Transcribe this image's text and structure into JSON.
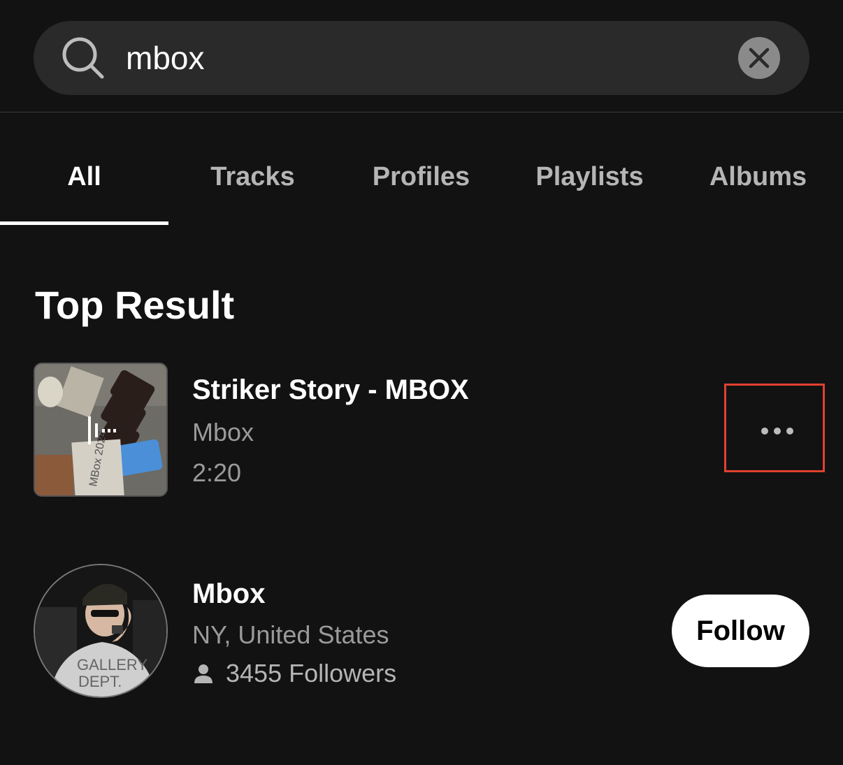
{
  "search": {
    "query": "mbox",
    "search_icon": "search-icon",
    "clear_icon": "close-circle-icon"
  },
  "tabs": [
    {
      "label": "All",
      "active": true
    },
    {
      "label": "Tracks",
      "active": false
    },
    {
      "label": "Profiles",
      "active": false
    },
    {
      "label": "Playlists",
      "active": false
    },
    {
      "label": "Albums",
      "active": false
    }
  ],
  "section": {
    "title": "Top Result"
  },
  "track": {
    "title": "Striker Story - MBOX",
    "artist": "Mbox",
    "duration": "2:20",
    "art_overlay_icon": "waveform-icon",
    "more_icon": "more-horizontal-icon",
    "highlight_color": "#e0412f"
  },
  "profile": {
    "name": "Mbox",
    "location": "NY, United States",
    "followers": "3455 Followers",
    "followers_icon": "person-icon",
    "follow_label": "Follow"
  }
}
